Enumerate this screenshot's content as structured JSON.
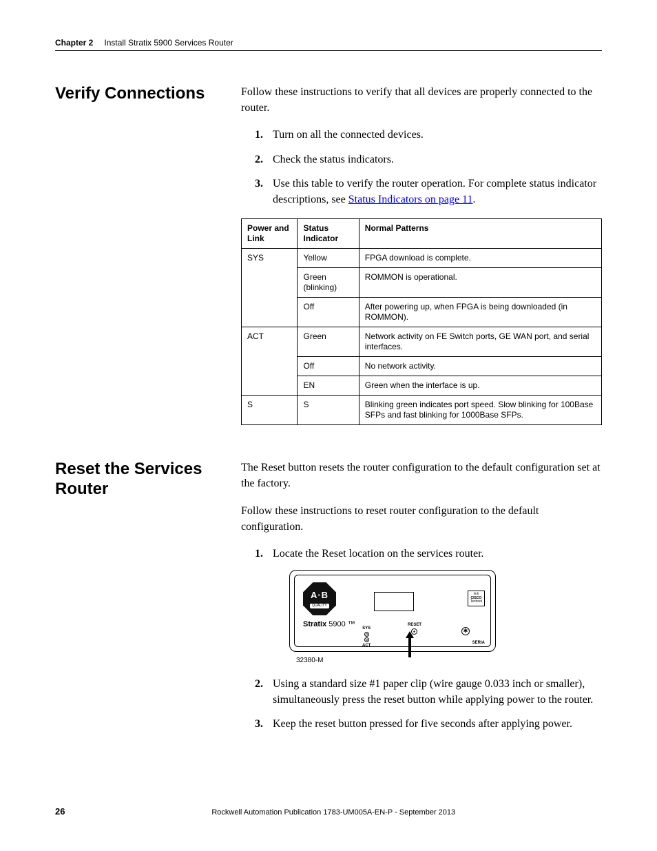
{
  "header": {
    "chapter": "Chapter 2",
    "title": "Install Stratix 5900 Services Router"
  },
  "sections": {
    "verify": {
      "heading": "Verify Connections",
      "intro": "Follow these instructions to verify that all devices are properly connected to the router.",
      "steps": {
        "s1": "Turn on all the connected devices.",
        "s2": "Check the status indicators.",
        "s3_pre": "Use this table to verify the router operation. For complete status indicator descriptions, see ",
        "s3_link": "Status Indicators on page 11",
        "s3_post": "."
      },
      "table": {
        "h1": "Power and Link",
        "h2": "Status Indicator",
        "h3": "Normal Patterns",
        "r1c1": "SYS",
        "r1c2": "Yellow",
        "r1c3": "FPGA download is complete.",
        "r2c2": "Green (blinking)",
        "r2c3": "ROMMON is operational.",
        "r3c2": "Off",
        "r3c3": "After powering up, when FPGA is being downloaded (in ROMMON).",
        "r4c1": "ACT",
        "r4c2": "Green",
        "r4c3": "Network activity on FE Switch ports, GE WAN port, and serial interfaces.",
        "r5c2": "Off",
        "r5c3": "No network activity.",
        "r6c2": "EN",
        "r6c3": "Green when the interface is up.",
        "r7c1": "S",
        "r7c2": "S",
        "r7c3": "Blinking green indicates port speed. Slow blinking for 100Base SFPs and fast blinking for 1000Base SFPs."
      }
    },
    "reset": {
      "heading": "Reset the Services Router",
      "p1": "The Reset button resets the router configuration to the default configuration set at the factory.",
      "p2": "Follow these instructions to reset router configuration to the default configuration.",
      "steps": {
        "s1": "Locate the Reset location on the services router.",
        "s2": "Using a standard size #1 paper clip (wire gauge 0.033 inch or smaller), simultaneously press the reset button while applying power to the router.",
        "s3": "Keep the reset button pressed for five seconds after applying power."
      },
      "diagram": {
        "ab": "A·B",
        "quality": "QUALITY",
        "product_b": "Stratix",
        "product_rest": " 5900 ™",
        "sys": "SYS",
        "act": "ACT",
        "reset": "RESET",
        "serial": "SERIA",
        "cisco1": "ılıılı",
        "cisco2": "CISCO",
        "cisco3": "Technol",
        "figure_id": "32380-M"
      }
    }
  },
  "footer": {
    "page": "26",
    "publication": "Rockwell Automation Publication 1783-UM005A-EN-P - September 2013"
  }
}
